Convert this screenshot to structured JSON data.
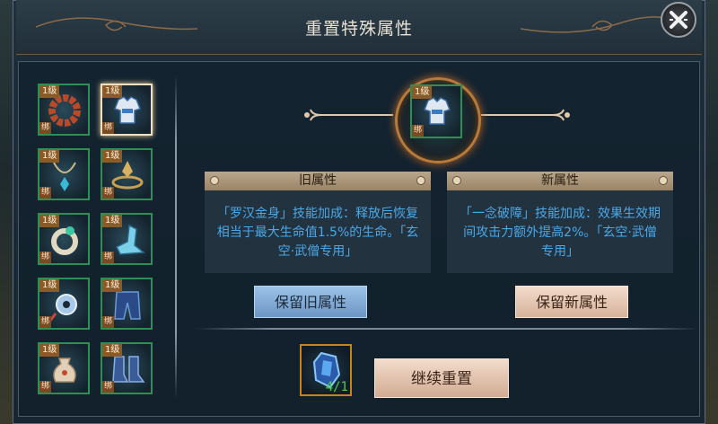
{
  "dialog": {
    "title": "重置特殊属性",
    "close_icon": "close-icon"
  },
  "equipment_list": [
    {
      "level": "1级",
      "bind": "绑",
      "icon": "prayer-beads-icon",
      "selected": false
    },
    {
      "level": "1级",
      "bind": "绑",
      "icon": "robe-armor-icon",
      "selected": true
    },
    {
      "level": "1级",
      "bind": "绑",
      "icon": "necklace-icon",
      "selected": false
    },
    {
      "level": "1级",
      "bind": "绑",
      "icon": "belt-icon",
      "selected": false
    },
    {
      "level": "1级",
      "bind": "绑",
      "icon": "ring-icon",
      "selected": false
    },
    {
      "level": "1级",
      "bind": "绑",
      "icon": "shoe-icon",
      "selected": false
    },
    {
      "level": "1级",
      "bind": "绑",
      "icon": "jade-pendant-icon",
      "selected": false
    },
    {
      "level": "1级",
      "bind": "绑",
      "icon": "pants-icon",
      "selected": false
    },
    {
      "level": "1级",
      "bind": "绑",
      "icon": "pouch-icon",
      "selected": false
    },
    {
      "level": "1级",
      "bind": "绑",
      "icon": "boots-icon",
      "selected": false
    }
  ],
  "selected_item": {
    "level": "1级",
    "bind": "绑",
    "icon": "robe-armor-icon"
  },
  "old_attribute": {
    "header": "旧属性",
    "text": "「罗汉金身」技能加成：释放后恢复相当于最大生命值1.5%的生命。「玄空·武僧专用」"
  },
  "new_attribute": {
    "header": "新属性",
    "text": "「一念破障」技能加成：效果生效期间攻击力额外提高2%。「玄空·武僧专用」"
  },
  "buttons": {
    "keep_old": "保留旧属性",
    "keep_new": "保留新属性",
    "continue_reset": "继续重置"
  },
  "material": {
    "icon": "blue-crystal-icon",
    "count": "4/1"
  },
  "colors": {
    "attr_text": "#4aa8e8",
    "selected_border": "#f0e0c0",
    "material_count": "#4ad04a"
  }
}
